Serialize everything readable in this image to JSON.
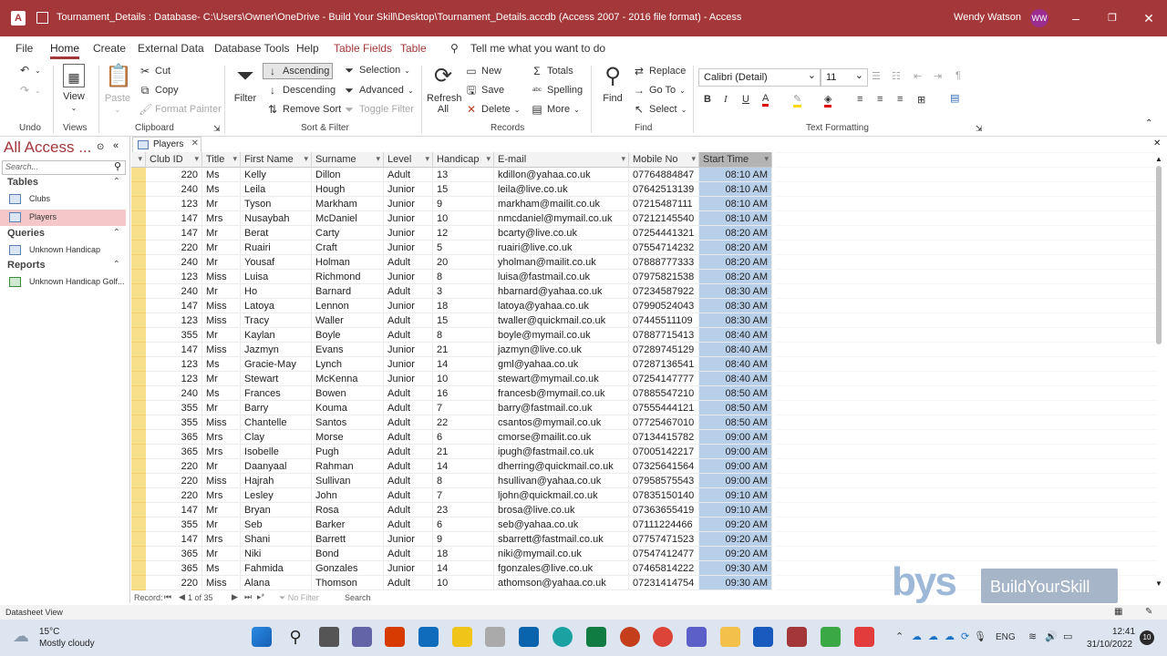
{
  "window": {
    "title": "Tournament_Details : Database- C:\\Users\\Owner\\OneDrive - Build Your Skill\\Desktop\\Tournament_Details.accdb (Access 2007 - 2016 file format)  -  Access",
    "user": "Wendy Watson",
    "user_initials": "WW"
  },
  "menu": {
    "tabs": [
      "File",
      "Home",
      "Create",
      "External Data",
      "Database Tools",
      "Help",
      "Table Fields",
      "Table"
    ],
    "tell_me": "Tell me what you want to do"
  },
  "ribbon": {
    "undo_label": "Undo",
    "views": {
      "view_label": "View",
      "group": "Views"
    },
    "clipboard": {
      "paste": "Paste",
      "cut": "Cut",
      "copy": "Copy",
      "format_painter": "Format Painter",
      "group": "Clipboard"
    },
    "sort_filter": {
      "filter": "Filter",
      "ascending": "Ascending",
      "descending": "Descending",
      "remove_sort": "Remove Sort",
      "selection": "Selection",
      "advanced": "Advanced",
      "toggle_filter": "Toggle Filter",
      "group": "Sort & Filter"
    },
    "records": {
      "refresh": "Refresh",
      "refresh_all": "All",
      "new": "New",
      "save": "Save",
      "delete": "Delete",
      "totals": "Totals",
      "spelling": "Spelling",
      "more": "More",
      "group": "Records"
    },
    "find": {
      "find": "Find",
      "replace": "Replace",
      "go_to": "Go To",
      "select": "Select",
      "group": "Find"
    },
    "text_formatting": {
      "font": "Calibri (Detail)",
      "size": "11",
      "group": "Text Formatting"
    }
  },
  "nav": {
    "title": "All Access ...",
    "search_placeholder": "Search...",
    "sections": [
      {
        "label": "Tables",
        "items": [
          "Clubs",
          "Players"
        ]
      },
      {
        "label": "Queries",
        "items": [
          "Unknown Handicap"
        ]
      },
      {
        "label": "Reports",
        "items": [
          "Unknown Handicap Golf..."
        ]
      }
    ],
    "selected": "Players"
  },
  "document_tab": "Players",
  "grid": {
    "columns": [
      "Club ID",
      "Title",
      "First Name",
      "Surname",
      "Level",
      "Handicap",
      "E-mail",
      "Mobile No",
      "Start Time"
    ],
    "rows": [
      [
        "220",
        "Ms",
        "Kelly",
        "Dillon",
        "Adult",
        "13",
        "kdillon@yahaa.co.uk",
        "07764884847",
        "08:10 AM"
      ],
      [
        "240",
        "Ms",
        "Leila",
        "Hough",
        "Junior",
        "15",
        "leila@live.co.uk",
        "07642513139",
        "08:10 AM"
      ],
      [
        "123",
        "Mr",
        "Tyson",
        "Markham",
        "Junior",
        "9",
        "markham@mailit.co.uk",
        "07215487111",
        "08:10 AM"
      ],
      [
        "147",
        "Mrs",
        "Nusaybah",
        "McDaniel",
        "Junior",
        "10",
        "nmcdaniel@mymail.co.uk",
        "07212145540",
        "08:10 AM"
      ],
      [
        "147",
        "Mr",
        "Berat",
        "Carty",
        "Junior",
        "12",
        "bcarty@live.co.uk",
        "07254441321",
        "08:20 AM"
      ],
      [
        "220",
        "Mr",
        "Ruairi",
        "Craft",
        "Junior",
        "5",
        "ruairi@live.co.uk",
        "07554714232",
        "08:20 AM"
      ],
      [
        "240",
        "Mr",
        "Yousaf",
        "Holman",
        "Adult",
        "20",
        "yholman@mailit.co.uk",
        "07888777333",
        "08:20 AM"
      ],
      [
        "123",
        "Miss",
        "Luisa",
        "Richmond",
        "Junior",
        "8",
        "luisa@fastmail.co.uk",
        "07975821538",
        "08:20 AM"
      ],
      [
        "240",
        "Mr",
        "Ho",
        "Barnard",
        "Adult",
        "3",
        "hbarnard@yahaa.co.uk",
        "07234587922",
        "08:30 AM"
      ],
      [
        "147",
        "Miss",
        "Latoya",
        "Lennon",
        "Junior",
        "18",
        "latoya@yahaa.co.uk",
        "07990524043",
        "08:30 AM"
      ],
      [
        "123",
        "Miss",
        "Tracy",
        "Waller",
        "Adult",
        "15",
        "twaller@quickmail.co.uk",
        "07445511109",
        "08:30 AM"
      ],
      [
        "355",
        "Mr",
        "Kaylan",
        "Boyle",
        "Adult",
        "8",
        "boyle@mymail.co.uk",
        "07887715413",
        "08:40 AM"
      ],
      [
        "147",
        "Miss",
        "Jazmyn",
        "Evans",
        "Junior",
        "21",
        "jazmyn@live.co.uk",
        "07289745129",
        "08:40 AM"
      ],
      [
        "123",
        "Ms",
        "Gracie-May",
        "Lynch",
        "Junior",
        "14",
        "gml@yahaa.co.uk",
        "07287136541",
        "08:40 AM"
      ],
      [
        "123",
        "Mr",
        "Stewart",
        "McKenna",
        "Junior",
        "10",
        "stewart@mymail.co.uk",
        "07254147777",
        "08:40 AM"
      ],
      [
        "240",
        "Ms",
        "Frances",
        "Bowen",
        "Adult",
        "16",
        "francesb@mymail.co.uk",
        "07885547210",
        "08:50 AM"
      ],
      [
        "355",
        "Mr",
        "Barry",
        "Kouma",
        "Adult",
        "7",
        "barry@fastmail.co.uk",
        "07555444121",
        "08:50 AM"
      ],
      [
        "355",
        "Miss",
        "Chantelle",
        "Santos",
        "Adult",
        "22",
        "csantos@mymail.co.uk",
        "07725467010",
        "08:50 AM"
      ],
      [
        "365",
        "Mrs",
        "Clay",
        "Morse",
        "Adult",
        "6",
        "cmorse@mailit.co.uk",
        "07134415782",
        "09:00 AM"
      ],
      [
        "365",
        "Mrs",
        "Isobelle",
        "Pugh",
        "Adult",
        "21",
        "ipugh@fastmail.co.uk",
        "07005142217",
        "09:00 AM"
      ],
      [
        "220",
        "Mr",
        "Daanyaal",
        "Rahman",
        "Adult",
        "14",
        "dherring@quickmail.co.uk",
        "07325641564",
        "09:00 AM"
      ],
      [
        "220",
        "Miss",
        "Hajrah",
        "Sullivan",
        "Adult",
        "8",
        "hsullivan@yahaa.co.uk",
        "07958575543",
        "09:00 AM"
      ],
      [
        "220",
        "Mrs",
        "Lesley",
        "John",
        "Adult",
        "7",
        "ljohn@quickmail.co.uk",
        "07835150140",
        "09:10 AM"
      ],
      [
        "147",
        "Mr",
        "Bryan",
        "Rosa",
        "Adult",
        "23",
        "brosa@live.co.uk",
        "07363655419",
        "09:10 AM"
      ],
      [
        "355",
        "Mr",
        "Seb",
        "Barker",
        "Adult",
        "6",
        "seb@yahaa.co.uk",
        "07111224466",
        "09:20 AM"
      ],
      [
        "147",
        "Mrs",
        "Shani",
        "Barrett",
        "Junior",
        "9",
        "sbarrett@fastmail.co.uk",
        "07757471523",
        "09:20 AM"
      ],
      [
        "365",
        "Mr",
        "Niki",
        "Bond",
        "Adult",
        "18",
        "niki@mymail.co.uk",
        "07547412477",
        "09:20 AM"
      ],
      [
        "365",
        "Ms",
        "Fahmida",
        "Gonzales",
        "Junior",
        "14",
        "fgonzales@live.co.uk",
        "07465814222",
        "09:30 AM"
      ],
      [
        "220",
        "Miss",
        "Alana",
        "Thomson",
        "Adult",
        "10",
        "athomson@yahaa.co.uk",
        "07231414754",
        "09:30 AM"
      ]
    ]
  },
  "record_nav": {
    "label": "Record:",
    "position": "1 of 35",
    "filter": "No Filter",
    "search": "Search"
  },
  "status": "Datasheet View",
  "logo": {
    "short": "bys",
    "text": "BuildYourSkill"
  },
  "taskbar": {
    "weather_temp": "15°C",
    "weather_desc": "Mostly cloudy",
    "lang": "ENG",
    "time": "12:41",
    "date": "31/10/2022",
    "notifications": "10"
  },
  "colors": {
    "access_red": "#a4373a",
    "selection_blue": "#b7cfe8",
    "record_selector": "#f7df8c"
  }
}
